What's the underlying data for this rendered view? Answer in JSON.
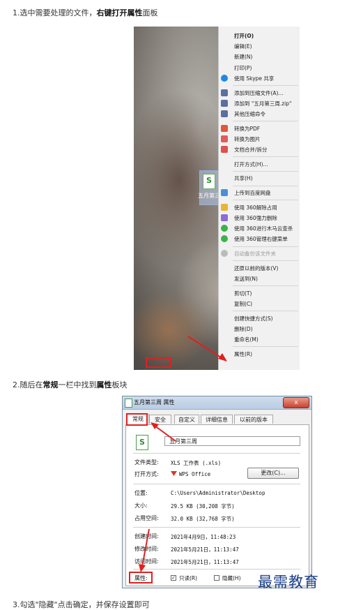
{
  "step1": {
    "prefix": "1.选中需要处理的文件，",
    "bold": "右键打开属性",
    "suffix": "面板"
  },
  "desktop_icon_label": "五月第三",
  "context_menu": {
    "items": [
      {
        "label": "打开(O)",
        "icon": "none",
        "bold": true
      },
      {
        "label": "编辑(E)",
        "icon": "none"
      },
      {
        "label": "新建(N)",
        "icon": "none"
      },
      {
        "label": "打印(P)",
        "icon": "none"
      },
      {
        "label": "使用 Skype 共享",
        "icon": "skype-icon"
      },
      {
        "label": "添加到压缩文件(A)...",
        "icon": "archive-icon"
      },
      {
        "label": "添加到 \"五月第三周.zip\"",
        "icon": "archive-icon"
      },
      {
        "label": "其他压缩命令",
        "icon": "archive-icon"
      },
      {
        "label": "转换为PDF",
        "icon": "pdf-icon"
      },
      {
        "label": "转换为图片",
        "icon": "image-icon"
      },
      {
        "label": "文档合并/拆分",
        "icon": "merge-icon"
      },
      {
        "label": "打开方式(H)...",
        "icon": "none"
      },
      {
        "label": "共享(H)",
        "icon": "none"
      },
      {
        "label": "上传到百度网盘",
        "icon": "cloud-icon"
      },
      {
        "label": "使用 360解除占用",
        "icon": "folder-icon"
      },
      {
        "label": "使用 360强力删除",
        "icon": "shred-icon"
      },
      {
        "label": "使用 360进行木马云查杀",
        "icon": "shield-360-icon"
      },
      {
        "label": "使用 360管理右键菜单",
        "icon": "shield-360-icon"
      },
      {
        "label": "自动备份该文件夹",
        "icon": "backup-icon",
        "disabled": true
      },
      {
        "label": "还原以前的版本(V)",
        "icon": "none"
      },
      {
        "label": "发送到(N)",
        "icon": "none"
      },
      {
        "label": "剪切(T)",
        "icon": "none"
      },
      {
        "label": "复制(C)",
        "icon": "none"
      },
      {
        "label": "创建快捷方式(S)",
        "icon": "none"
      },
      {
        "label": "删除(D)",
        "icon": "none"
      },
      {
        "label": "重命名(M)",
        "icon": "none"
      },
      {
        "label": "属性(R)",
        "icon": "none"
      }
    ]
  },
  "step2": {
    "prefix": "2.随后在",
    "bold1": "常规",
    "mid": "一栏中找到",
    "bold2": "属性",
    "suffix": "板块"
  },
  "dialog": {
    "title": "五月第三周 属性",
    "close": "x",
    "tabs": [
      "常规",
      "安全",
      "自定义",
      "详细信息",
      "以前的版本"
    ],
    "file_name": "五月第三周",
    "rows": {
      "type_label": "文件类型:",
      "type_value": "XLS 工作表 (.xls)",
      "open_label": "打开方式:",
      "open_value": "WPS Office",
      "change_button": "更改(C)...",
      "location_label": "位置:",
      "location_value": "C:\\Users\\Administrator\\Desktop",
      "size_label": "大小:",
      "size_value": "29.5 KB (30,208 字节)",
      "disk_label": "占用空间:",
      "disk_value": "32.0 KB (32,768 字节)",
      "created_label": "创建时间:",
      "created_value": "2021年4月9日，11:48:23",
      "modified_label": "修改时间:",
      "modified_value": "2021年5月21日，11:13:47",
      "accessed_label": "访问时间:",
      "accessed_value": "2021年5月21日，11:13:47",
      "attr_label": "属性:",
      "readonly_label": "只读(R)",
      "hidden_label": "隐藏(H)"
    }
  },
  "watermark": "最需教育",
  "step3_partial": "3.勾选\"隐藏\"点击确定，并保存设置即可",
  "colors": {
    "highlight": "#e02020",
    "watermark": "#1b3f88"
  }
}
